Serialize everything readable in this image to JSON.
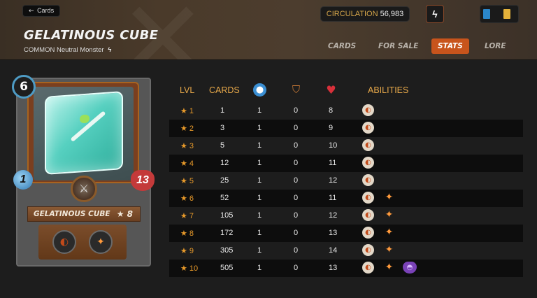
{
  "header": {
    "back_label": "Cards",
    "title": "GELATINOUS CUBE",
    "subtitle": "COMMON Neutral Monster",
    "circulation_label": "CIRCULATION",
    "circulation_value": "56,983",
    "tabs": [
      "CARDS",
      "FOR SALE",
      "STATS",
      "LORE"
    ],
    "active_tab": "STATS"
  },
  "card": {
    "mana": "6",
    "speed": "1",
    "health": "13",
    "name": "GELATINOUS CUBE",
    "level": "★ 8"
  },
  "table": {
    "columns": [
      "LVL",
      "CARDS",
      "speed-icon",
      "armor-icon",
      "health-icon",
      "ABILITIES"
    ],
    "headers": {
      "lvl": "LVL",
      "cards": "CARDS",
      "abilities": "ABILITIES"
    },
    "rows": [
      {
        "lvl": "★ 1",
        "cards": "1",
        "speed": "1",
        "armor": "0",
        "health": "8",
        "abilities": [
          "scavenger"
        ]
      },
      {
        "lvl": "★ 2",
        "cards": "3",
        "speed": "1",
        "armor": "0",
        "health": "9",
        "abilities": [
          "scavenger"
        ]
      },
      {
        "lvl": "★ 3",
        "cards": "5",
        "speed": "1",
        "armor": "0",
        "health": "10",
        "abilities": [
          "scavenger"
        ]
      },
      {
        "lvl": "★ 4",
        "cards": "12",
        "speed": "1",
        "armor": "0",
        "health": "11",
        "abilities": [
          "scavenger"
        ]
      },
      {
        "lvl": "★ 5",
        "cards": "25",
        "speed": "1",
        "armor": "0",
        "health": "12",
        "abilities": [
          "scavenger"
        ]
      },
      {
        "lvl": "★ 6",
        "cards": "52",
        "speed": "1",
        "armor": "0",
        "health": "11",
        "abilities": [
          "scavenger",
          "thorns"
        ]
      },
      {
        "lvl": "★ 7",
        "cards": "105",
        "speed": "1",
        "armor": "0",
        "health": "12",
        "abilities": [
          "scavenger",
          "thorns"
        ]
      },
      {
        "lvl": "★ 8",
        "cards": "172",
        "speed": "1",
        "armor": "0",
        "health": "13",
        "abilities": [
          "scavenger",
          "thorns"
        ]
      },
      {
        "lvl": "★ 9",
        "cards": "305",
        "speed": "1",
        "armor": "0",
        "health": "14",
        "abilities": [
          "scavenger",
          "thorns"
        ]
      },
      {
        "lvl": "★ 10",
        "cards": "505",
        "speed": "1",
        "armor": "0",
        "health": "13",
        "abilities": [
          "scavenger",
          "thorns",
          "shield"
        ]
      }
    ]
  },
  "colors": {
    "accent": "#e8a94a",
    "active_tab": "#c8541c",
    "star": "#e89a2a"
  }
}
